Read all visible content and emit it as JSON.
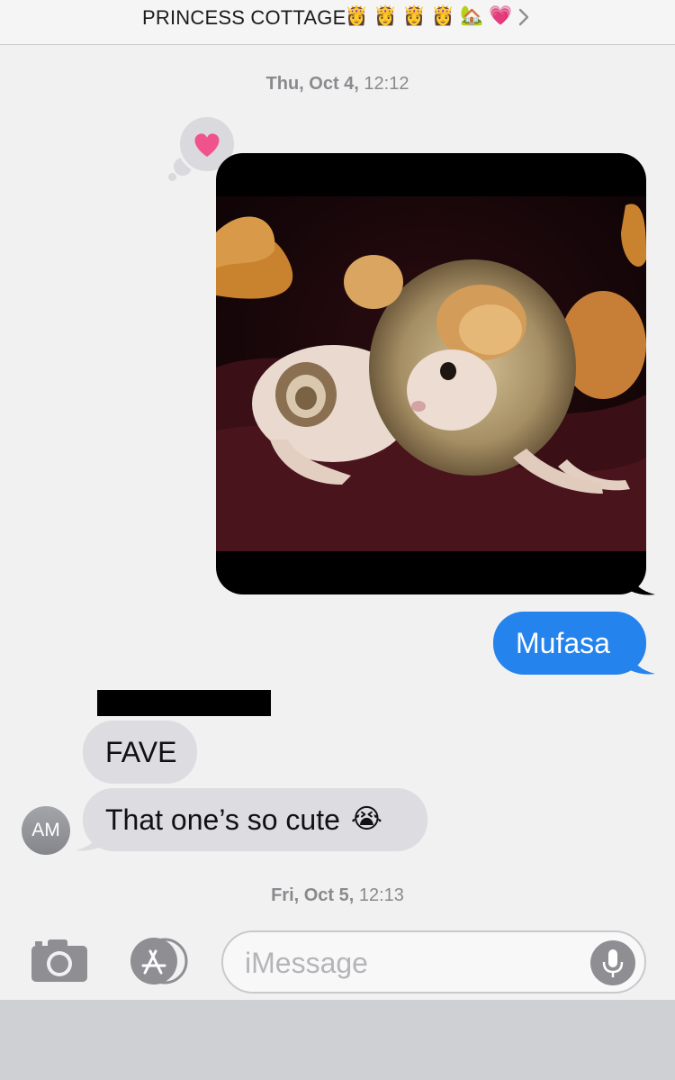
{
  "header": {
    "title": "PRINCESS COTTAGE",
    "emojis": [
      "👸",
      "👸",
      "👸",
      "👸",
      "🏡",
      "💗"
    ],
    "chevron": "chevron-right-icon"
  },
  "timestamps": [
    {
      "day": "Thu, Oct 4,",
      "time": "12:12"
    },
    {
      "day": "Fri, Oct 5,",
      "time": "12:13"
    }
  ],
  "tapback": {
    "icon": "heart-icon",
    "color": "#f0538a"
  },
  "messages": {
    "sent_text": "Mufasa",
    "recv1": "FAVE",
    "recv2": "That one’s so cute",
    "recv2_emoji": "😭"
  },
  "avatar": {
    "initials": "AM"
  },
  "composer": {
    "placeholder": "iMessage"
  },
  "colors": {
    "sent": "#2483ec",
    "received": "#dcdce1",
    "background": "#f1f1f1"
  }
}
